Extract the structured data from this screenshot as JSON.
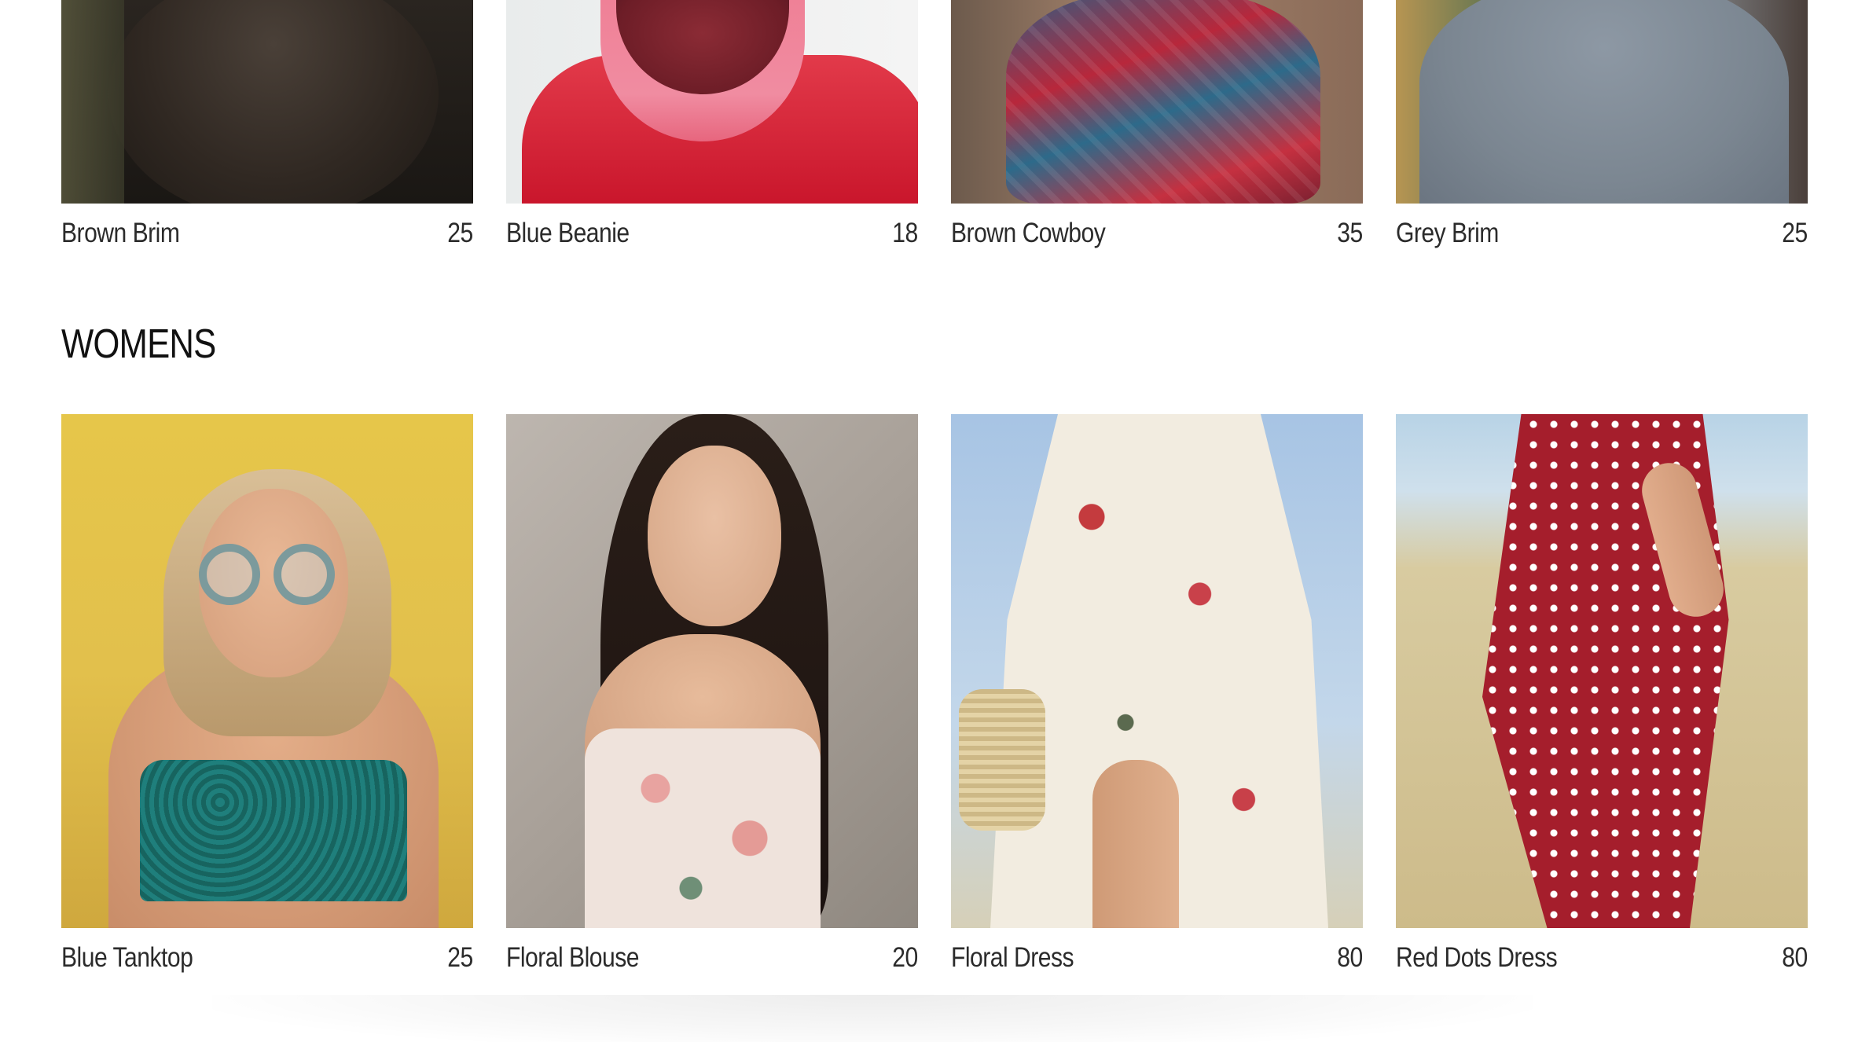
{
  "sections": [
    {
      "title": "",
      "items": [
        {
          "name": "Brown Brim",
          "price": "25",
          "image": "woman-long-hair-back-photo"
        },
        {
          "name": "Blue Beanie",
          "price": "18",
          "image": "red-pink-hooded-jacket-photo"
        },
        {
          "name": "Brown Cowboy",
          "price": "35",
          "image": "patterned-scarf-photo"
        },
        {
          "name": "Grey Brim",
          "price": "25",
          "image": "grey-sweater-back-photo"
        }
      ]
    },
    {
      "title": "WOMENS",
      "items": [
        {
          "name": "Blue Tanktop",
          "price": "25",
          "image": "woman-round-glasses-teal-top-photo"
        },
        {
          "name": "Floral Blouse",
          "price": "20",
          "image": "woman-floral-offshoulder-blouse-photo"
        },
        {
          "name": "Floral Dress",
          "price": "80",
          "image": "floral-wrap-dress-photo"
        },
        {
          "name": "Red Dots Dress",
          "price": "80",
          "image": "red-polka-dot-dress-photo"
        }
      ]
    }
  ]
}
